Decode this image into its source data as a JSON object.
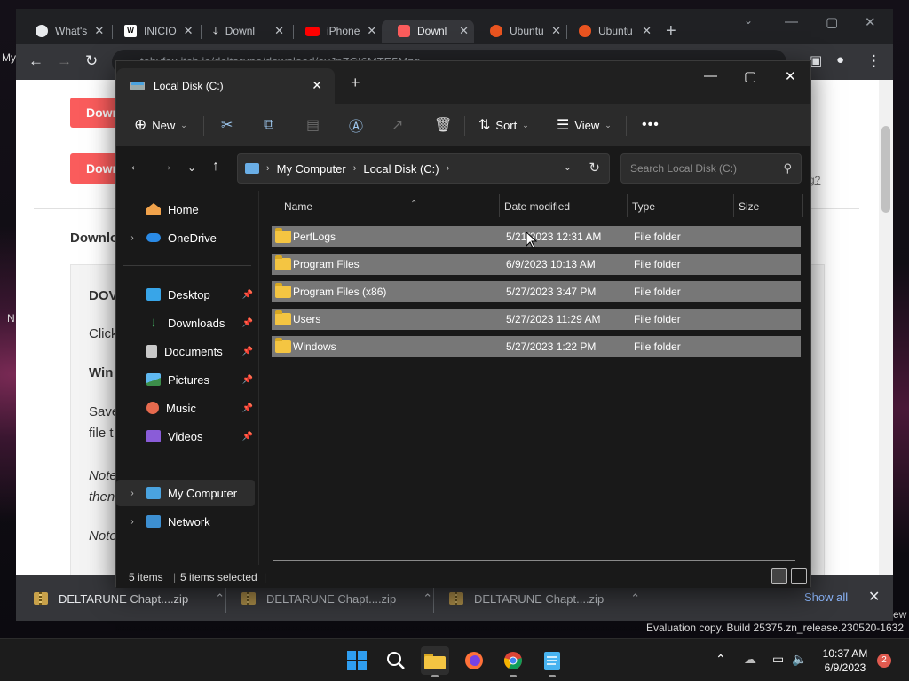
{
  "colors": {
    "accent": "#60cdff",
    "chrome_download_red": "#fa5c5c",
    "selection_gray": "#777777",
    "folder_yellow": "#f4c542",
    "notification_red": "#e05a4f"
  },
  "desktop": {
    "label_my": "My",
    "label_n": "N"
  },
  "chrome": {
    "tabs": [
      {
        "label": "What's",
        "icon": "chrome-icon"
      },
      {
        "label": "INICIO",
        "icon": "wix-icon"
      },
      {
        "label": "Downl",
        "icon": "download-icon"
      },
      {
        "label": "iPhone",
        "icon": "youtube-icon"
      },
      {
        "label": "Downl",
        "icon": "itch-icon"
      },
      {
        "label": "Ubuntu",
        "icon": "ubuntu-icon"
      },
      {
        "label": "Ubuntu",
        "icon": "ubuntu-icon"
      }
    ],
    "url": "tobyfox.itch.io/deltarune/download/eyJpZCI6MTE5Mzg..."
  },
  "webpage": {
    "download_label": "Down",
    "text_downlo": "Downlo",
    "text_dov": "DOV",
    "text_click": "Click",
    "text_win": "Win",
    "text_save": "Save",
    "text_file": "file t",
    "text_note1": "Note",
    "text_then": "then",
    "text_note2": "Note",
    "text_link": "g?"
  },
  "downloads_bar": {
    "items": [
      {
        "name": "DELTARUNE Chapt....zip"
      },
      {
        "name": "DELTARUNE Chapt....zip"
      },
      {
        "name": "DELTARUNE Chapt....zip"
      }
    ],
    "show_all": "Show all"
  },
  "explorer": {
    "tab_title": "Local Disk (C:)",
    "commands": {
      "new": "New",
      "sort": "Sort",
      "view": "View"
    },
    "breadcrumb": [
      "My Computer",
      "Local Disk (C:)"
    ],
    "search_placeholder": "Search Local Disk (C:)",
    "sidebar": [
      {
        "label": "Home",
        "icon": "home-icon",
        "pinned": false,
        "expander": false
      },
      {
        "label": "OneDrive",
        "icon": "cloud-icon",
        "pinned": false,
        "expander": true
      },
      {
        "label": "Desktop",
        "icon": "desktop-icon",
        "pinned": true,
        "expander": false
      },
      {
        "label": "Downloads",
        "icon": "downloads-icon",
        "pinned": true,
        "expander": false
      },
      {
        "label": "Documents",
        "icon": "documents-icon",
        "pinned": true,
        "expander": false
      },
      {
        "label": "Pictures",
        "icon": "pictures-icon",
        "pinned": true,
        "expander": false
      },
      {
        "label": "Music",
        "icon": "music-icon",
        "pinned": true,
        "expander": false
      },
      {
        "label": "Videos",
        "icon": "videos-icon",
        "pinned": true,
        "expander": false
      },
      {
        "label": "My Computer",
        "icon": "computer-icon",
        "pinned": false,
        "expander": true,
        "selected": true
      },
      {
        "label": "Network",
        "icon": "network-icon",
        "pinned": false,
        "expander": true
      }
    ],
    "columns": [
      "Name",
      "Date modified",
      "Type",
      "Size"
    ],
    "rows": [
      {
        "name": "PerfLogs",
        "date": "5/21/2023 12:31 AM",
        "type": "File folder"
      },
      {
        "name": "Program Files",
        "date": "6/9/2023 10:13 AM",
        "type": "File folder"
      },
      {
        "name": "Program Files (x86)",
        "date": "5/27/2023 3:47 PM",
        "type": "File folder"
      },
      {
        "name": "Users",
        "date": "5/27/2023 11:29 AM",
        "type": "File folder"
      },
      {
        "name": "Windows",
        "date": "5/27/2023 1:22 PM",
        "type": "File folder"
      }
    ],
    "status": {
      "items": "5 items",
      "selected": "5 items selected"
    }
  },
  "watermark": {
    "line1": "Evaluation copy. Build 25375.zn_release.230520-1632",
    "edge_text": "ew"
  },
  "taskbar": {
    "time": "10:37 AM",
    "date": "6/9/2023",
    "notifications": "2"
  }
}
